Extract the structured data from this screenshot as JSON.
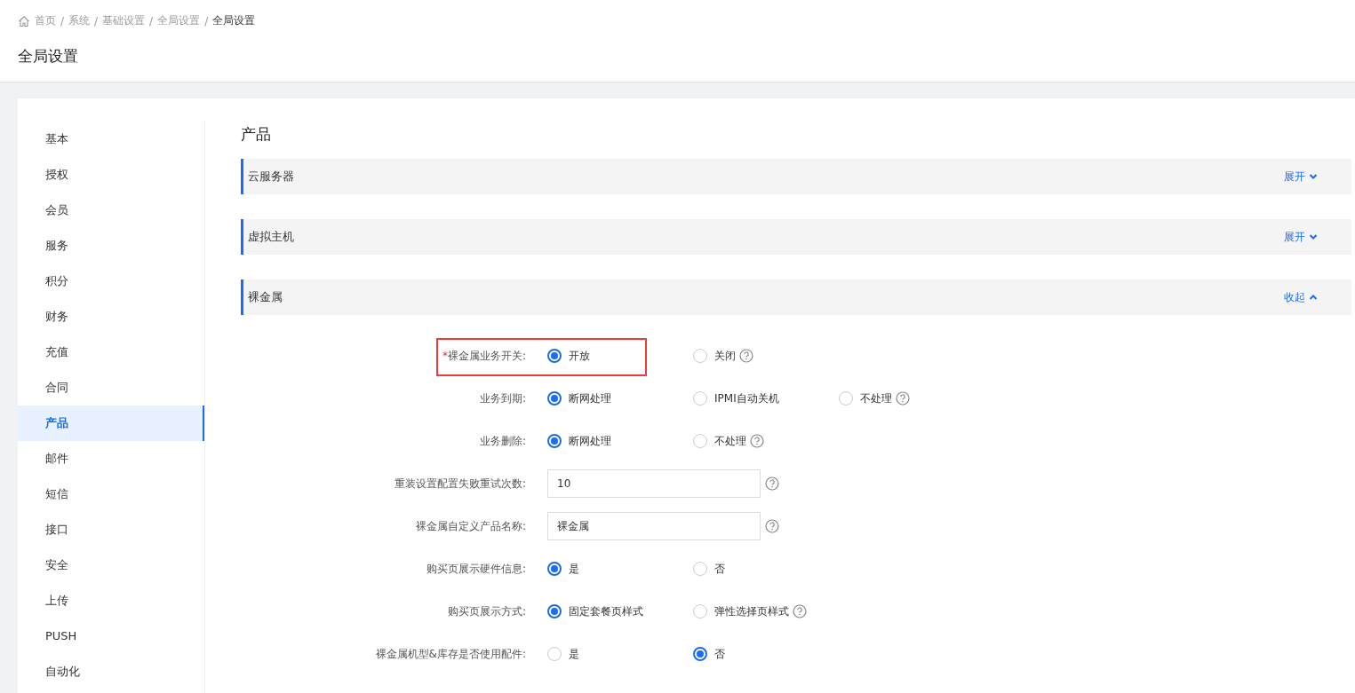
{
  "breadcrumb": [
    {
      "label": "首页",
      "current": false
    },
    {
      "separator": "/",
      "label": "系统",
      "current": false
    },
    {
      "separator": "/",
      "label": "基础设置",
      "current": false
    },
    {
      "separator": "/",
      "label": "全局设置",
      "current": false
    },
    {
      "separator": "/",
      "label": "全局设置",
      "current": true
    }
  ],
  "page_title": "全局设置",
  "sidebar": {
    "items": [
      {
        "label": "基本",
        "selected": false
      },
      {
        "label": "授权",
        "selected": false
      },
      {
        "label": "会员",
        "selected": false
      },
      {
        "label": "服务",
        "selected": false
      },
      {
        "label": "积分",
        "selected": false
      },
      {
        "label": "财务",
        "selected": false
      },
      {
        "label": "充值",
        "selected": false
      },
      {
        "label": "合同",
        "selected": false
      },
      {
        "label": "产品",
        "selected": true
      },
      {
        "label": "邮件",
        "selected": false
      },
      {
        "label": "短信",
        "selected": false
      },
      {
        "label": "接口",
        "selected": false
      },
      {
        "label": "安全",
        "selected": false
      },
      {
        "label": "上传",
        "selected": false
      },
      {
        "label": "PUSH",
        "selected": false
      },
      {
        "label": "自动化",
        "selected": false
      }
    ]
  },
  "content_title": "产品",
  "sections": [
    {
      "title": "云服务器",
      "toggle": "展开",
      "expanded": false
    },
    {
      "title": "虚拟主机",
      "toggle": "展开",
      "expanded": false
    },
    {
      "title": "裸金属",
      "toggle": "收起",
      "expanded": true
    }
  ],
  "form": [
    {
      "kind": "radio",
      "label": "裸金属业务开关:",
      "required_mark": "*",
      "highlighted": true,
      "options": [
        {
          "label": "开放",
          "selected": true,
          "help": false
        },
        {
          "label": "关闭",
          "selected": false,
          "help": true
        }
      ]
    },
    {
      "kind": "radio",
      "label": "业务到期:",
      "highlighted": false,
      "options": [
        {
          "label": "断网处理",
          "selected": true,
          "help": false
        },
        {
          "label": "IPMI自动关机",
          "selected": false,
          "help": false
        },
        {
          "label": "不处理",
          "selected": false,
          "help": true
        }
      ]
    },
    {
      "kind": "radio",
      "label": "业务删除:",
      "highlighted": false,
      "options": [
        {
          "label": "断网处理",
          "selected": true,
          "help": false
        },
        {
          "label": "不处理",
          "selected": false,
          "help": true
        }
      ]
    },
    {
      "kind": "input",
      "label": "重装设置配置失败重试次数:",
      "highlighted": false,
      "value": "10",
      "help": true
    },
    {
      "kind": "input",
      "label": "裸金属自定义产品名称:",
      "highlighted": false,
      "value": "裸金属",
      "help": true
    },
    {
      "kind": "radio",
      "label": "购买页展示硬件信息:",
      "highlighted": false,
      "options": [
        {
          "label": "是",
          "selected": true,
          "help": false
        },
        {
          "label": "否",
          "selected": false,
          "help": false
        }
      ]
    },
    {
      "kind": "radio",
      "label": "购买页展示方式:",
      "highlighted": false,
      "options": [
        {
          "label": "固定套餐页样式",
          "selected": true,
          "help": false
        },
        {
          "label": "弹性选择页样式",
          "selected": false,
          "help": true
        }
      ]
    },
    {
      "kind": "radio",
      "label": "裸金属机型&库存是否使用配件:",
      "highlighted": false,
      "options": [
        {
          "label": "是",
          "selected": false,
          "help": false
        },
        {
          "label": "否",
          "selected": true,
          "help": false
        }
      ]
    }
  ]
}
